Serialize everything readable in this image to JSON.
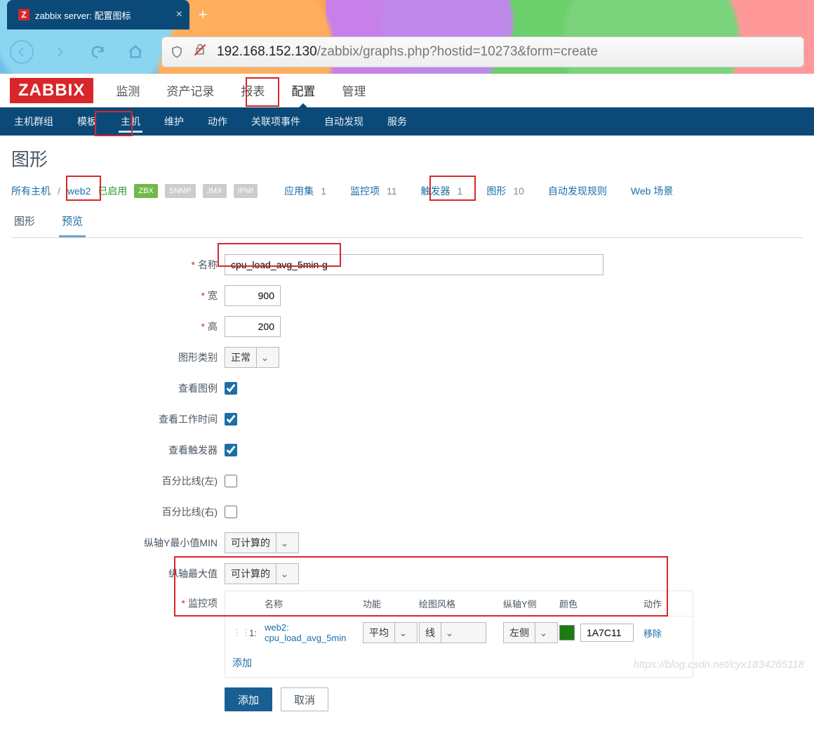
{
  "browser": {
    "tab_title": "zabbix server: 配置图标",
    "url_host": "192.168.152.130",
    "url_path": "/zabbix/graphs.php?hostid=10273&form=create"
  },
  "topnav": {
    "items": [
      "监测",
      "资产记录",
      "报表",
      "配置",
      "管理"
    ],
    "active": "配置"
  },
  "subnav": {
    "items": [
      "主机群组",
      "模板",
      "主机",
      "维护",
      "动作",
      "关联项事件",
      "自动发现",
      "服务"
    ],
    "active": "主机"
  },
  "page_title": "图形",
  "crumb": {
    "all_hosts": "所有主机",
    "host": "web2",
    "enabled": "已启用",
    "badges": [
      "ZBX",
      "SNMP",
      "JMX",
      "IPMI"
    ],
    "links": [
      {
        "label": "应用集",
        "count": "1"
      },
      {
        "label": "监控项",
        "count": "11"
      },
      {
        "label": "触发器",
        "count": "1"
      },
      {
        "label": "图形",
        "count": "10"
      },
      {
        "label": "自动发现规则",
        "count": ""
      },
      {
        "label": "Web 场景",
        "count": ""
      }
    ],
    "sep": "/"
  },
  "tabs": {
    "items": [
      "图形",
      "预览"
    ],
    "active": "预览"
  },
  "form": {
    "labels": {
      "name": "名称",
      "width": "宽",
      "height": "高",
      "type": "图形类别",
      "legend": "查看图例",
      "worktime": "查看工作时间",
      "trigger": "查看触发器",
      "pct_left": "百分比线(左)",
      "pct_right": "百分比线(右)",
      "ymin": "纵轴Y最小值MIN",
      "ymax": "纵轴最大值",
      "items": "监控项"
    },
    "values": {
      "name": "cpu_load_avg_5min-g",
      "width": "900",
      "height": "200",
      "type": "正常",
      "legend": true,
      "worktime": true,
      "trigger": true,
      "pct_left": false,
      "pct_right": false,
      "ymin": "可计算的",
      "ymax": "可计算的"
    }
  },
  "items_table": {
    "headers": {
      "name": "名称",
      "fn": "功能",
      "style": "绘图风格",
      "side": "纵轴Y侧",
      "color": "颜色",
      "act": "动作"
    },
    "rows": [
      {
        "num": "1:",
        "host": "web2:",
        "item": "cpu_load_avg_5min",
        "fn": "平均",
        "style": "线",
        "side": "左侧",
        "color": "1A7C11",
        "swatch": "#1A7C11",
        "remove": "移除"
      }
    ],
    "add": "添加"
  },
  "buttons": {
    "submit": "添加",
    "cancel": "取消"
  },
  "watermark": "https://blog.csdn.net/cyx1834265118"
}
